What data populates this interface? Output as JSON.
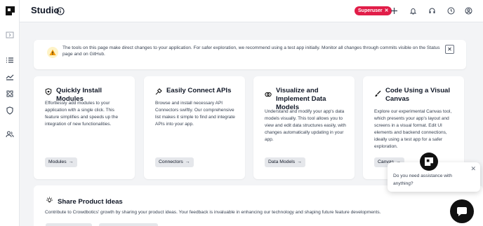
{
  "header": {
    "title": "Studio",
    "badge_label": "Superuser",
    "badge_close": "✕"
  },
  "sidebar": {
    "items": [
      {
        "icon": "collapse-icon"
      },
      {
        "icon": "list-icon"
      },
      {
        "icon": "chart-line-icon"
      },
      {
        "icon": "puzzle-icon"
      },
      {
        "icon": "shield-icon"
      },
      {
        "icon": "users-icon"
      }
    ]
  },
  "alert": {
    "text": "The tools on this page make direct changes to your application. For safer exploration, we recommend using a test app initially. Monitor all changes through commits visible on the Status page and on GitHub.",
    "close": "✕"
  },
  "cards": [
    {
      "title": "Quickly Install Modules",
      "description": "Effortlessly add modules to your application with a single click. This feature simplifies and speeds up the integration of new functionalities.",
      "button": "Modules",
      "icon": "shield-heart-icon"
    },
    {
      "title": "Easily Connect APIs",
      "description": "Browse and install necessary API Connectors swiftly. Our comprehensive list makes it simple to find and integrate APIs into your app.",
      "button": "Connectors",
      "icon": "plug-icon"
    },
    {
      "title": "Visualize and Implement Data Models",
      "description": "Understand and modify your app's data models visually. This tool allows you to view and edit data structures easily, with changes automatically updating in your app.",
      "button": "Data Models",
      "icon": "link-rings-icon"
    },
    {
      "title": "Code Using a Visual Canvas",
      "description": "Explore our experimental Canvas tool, which presents your app's layout and screens in a visual format. Edit UI elements and backend connections, ideally using a test app for a safer exploration.",
      "button": "Canvas",
      "icon": "brush-icon"
    }
  ],
  "button_arrow": "→",
  "ideas": {
    "title": "Share Product Ideas",
    "text": "Contribute to Crowdbotics' growth by sharing your product ideas. Your feedback is invaluable in enhancing our technology and shaping future feature developments."
  },
  "chat": {
    "message": "Do you need assistance with anything?",
    "close": "✕"
  }
}
